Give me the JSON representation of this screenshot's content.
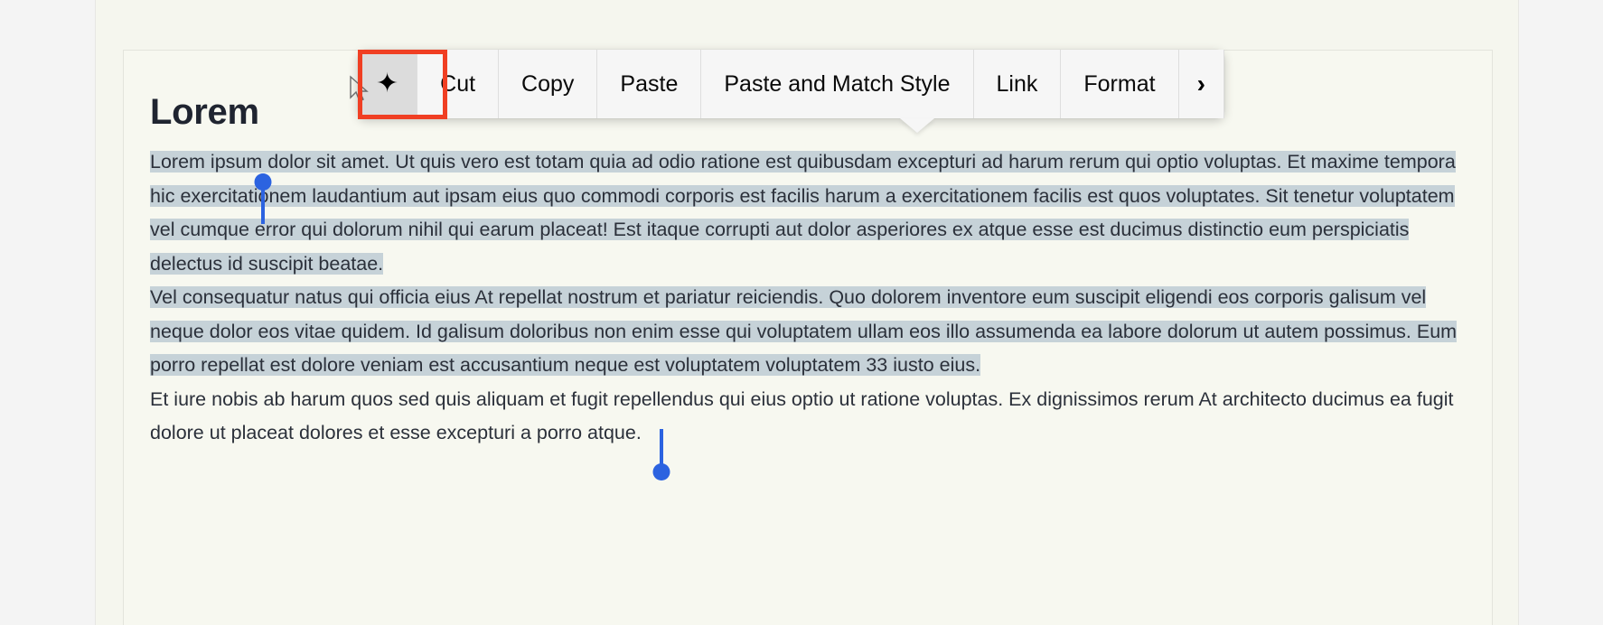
{
  "document": {
    "title": "Lorem",
    "paragraphs": [
      {
        "id": "p1",
        "selected_text": "Lorem ipsum dolor sit amet. Ut quis vero est totam quia ad odio ratione est quibusdam excepturi ad harum rerum qui optio voluptas. Et maxime tempora hic exercitationem laudantium aut ipsam eius quo commodi corporis est facilis harum a exercitationem facilis est quos voluptates. Sit tenetur voluptatem vel cumque error qui dolorum nihil qui earum placeat! Est itaque corrupti aut dolor asperiores ex atque esse est ducimus distinctio eum perspiciatis delectus id suscipit beatae."
      },
      {
        "id": "p2",
        "selected_text": "Vel consequatur natus qui officia eius At repellat nostrum et pariatur reiciendis. Quo dolorem inventore eum suscipit eligendi eos corporis galisum vel neque dolor eos vitae quidem. Id galisum doloribus non enim esse qui voluptatem ullam eos illo assumenda ea labore dolorum ut autem possimus. Eum porro repellat est dolore veniam est accusantium neque est voluptatem voluptatem 33 iusto eius."
      },
      {
        "id": "p3",
        "text": "Et iure nobis ab harum quos sed quis aliquam et fugit repellendus qui eius optio ut ratione voluptas. Ex dignissimos rerum At architecto ducimus ea fugit dolore ut placeat dolores et esse excepturi a porro atque."
      }
    ]
  },
  "context_menu": {
    "items": [
      {
        "id": "ai",
        "label": "✦",
        "kind": "icon",
        "icon": "sparkle-icon",
        "active": true
      },
      {
        "id": "cut",
        "label": "Cut",
        "kind": "text"
      },
      {
        "id": "copy",
        "label": "Copy",
        "kind": "text"
      },
      {
        "id": "paste",
        "label": "Paste",
        "kind": "text"
      },
      {
        "id": "paste_match",
        "label": "Paste and Match Style",
        "kind": "text"
      },
      {
        "id": "link",
        "label": "Link",
        "kind": "text"
      },
      {
        "id": "format",
        "label": "Format",
        "kind": "text"
      },
      {
        "id": "more",
        "label": "›",
        "kind": "chevron",
        "icon": "chevron-right-icon"
      }
    ]
  },
  "colors": {
    "selection_highlight": "#c6d2d8",
    "selection_handle": "#2c63e0",
    "highlight_box": "#f03f23",
    "menu_background": "#f6f6f6",
    "menu_active_item": "#dcdcdc",
    "page_background": "#f5f6ee",
    "card_background": "#f7f8f0",
    "text": "#2b303a"
  }
}
